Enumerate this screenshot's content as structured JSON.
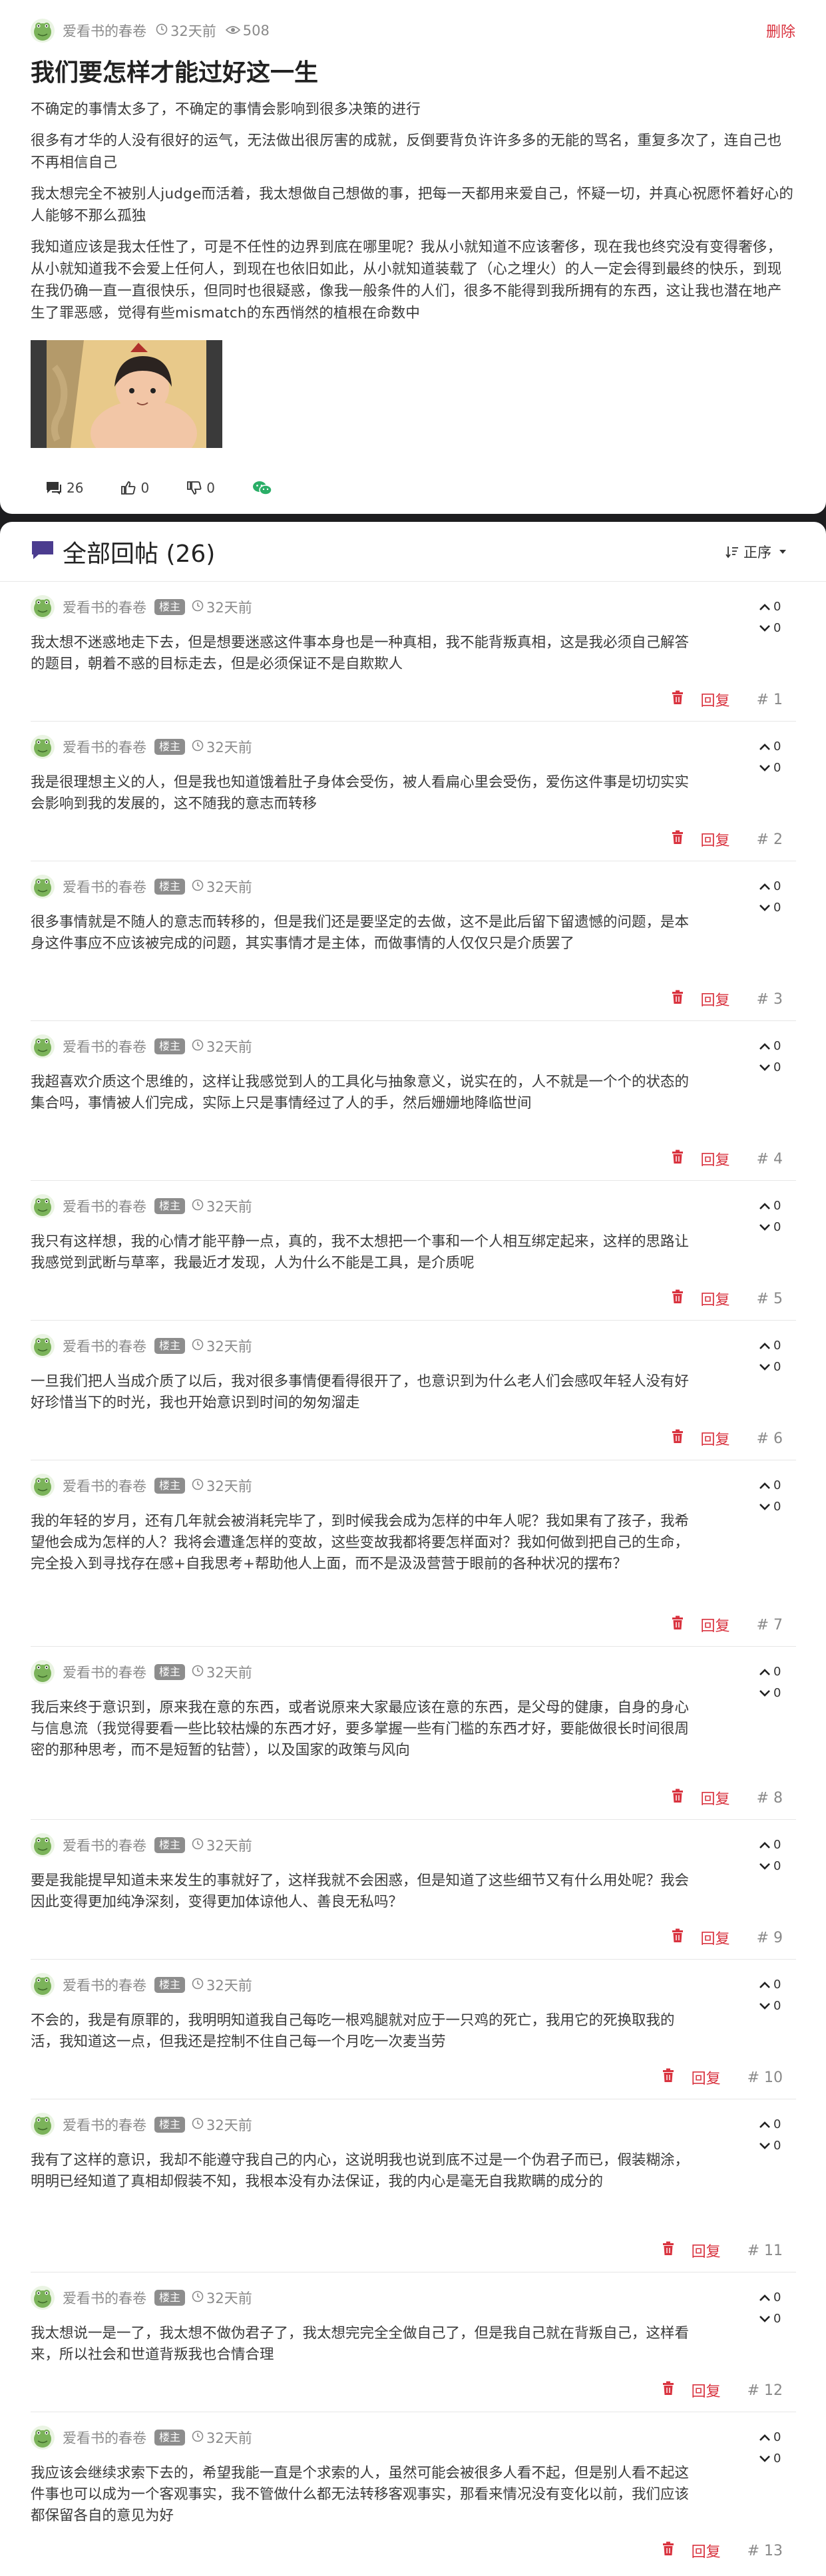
{
  "post": {
    "author": "爱看书的春卷",
    "time": "32天前",
    "views": "508",
    "delete_label": "删除",
    "title": "我们要怎样才能过好这一生",
    "paragraphs": [
      "不确定的事情太多了，不确定的事情会影响到很多决策的进行",
      "很多有才华的人没有很好的运气，无法做出很厉害的成就，反倒要背负许许多多的无能的骂名，重复多次了，连自己也不再相信自己",
      "我太想完全不被别人judge而活着，我太想做自己想做的事，把每一天都用来爱自己，怀疑一切，并真心祝愿怀着好心的人能够不那么孤独",
      "我知道应该是我太任性了，可是不任性的边界到底在哪里呢？我从小就知道不应该奢侈，现在我也终究没有变得奢侈，从小就知道我不会爱上任何人，到现在也依旧如此，从小就知道装载了（心之埋火）的人一定会得到最终的快乐，到现在我仍确一直一直很快乐，但同时也很疑惑，像我一般条件的人们，很多不能得到我所拥有的东西，这让我也潜在地产生了罪恶感，觉得有些mismatch的东西悄然的植根在命数中"
    ],
    "actions": {
      "comments": "26",
      "likes": "0",
      "dislikes": "0"
    }
  },
  "replies_header": {
    "title": "全部回帖 (26)",
    "sort_label": "正序"
  },
  "badge_label": "楼主",
  "reply_label": "回复",
  "replies": [
    {
      "author": "爱看书的春卷",
      "time": "32天前",
      "up": "0",
      "down": "0",
      "floor": "# 1",
      "body": "我太想不迷惑地走下去，但是想要迷惑这件事本身也是一种真相，我不能背叛真相，这是我必须自己解答的题目，朝着不惑的目标走去，但是必须保证不是自欺欺人"
    },
    {
      "author": "爱看书的春卷",
      "time": "32天前",
      "up": "0",
      "down": "0",
      "floor": "# 2",
      "body": "我是很理想主义的人，但是我也知道饿着肚子身体会受伤，被人看扁心里会受伤，爱伤这件事是切切实实会影响到我的发展的，这不随我的意志而转移"
    },
    {
      "author": "爱看书的春卷",
      "time": "32天前",
      "up": "0",
      "down": "0",
      "floor": "# 3",
      "body": "很多事情就是不随人的意志而转移的，但是我们还是要坚定的去做，这不是此后留下留遗憾的问题，是本身这件事应不应该被完成的问题，其实事情才是主体，而做事情的人仅仅只是介质罢了"
    },
    {
      "author": "爱看书的春卷",
      "time": "32天前",
      "up": "0",
      "down": "0",
      "floor": "# 4",
      "body": "我超喜欢介质这个思维的，这样让我感觉到人的工具化与抽象意义，说实在的，人不就是一个个的状态的集合吗，事情被人们完成，实际上只是事情经过了人的手，然后姗姗地降临世间"
    },
    {
      "author": "爱看书的春卷",
      "time": "32天前",
      "up": "0",
      "down": "0",
      "floor": "# 5",
      "body": "我只有这样想，我的心情才能平静一点，真的，我不太想把一个事和一个人相互绑定起来，这样的思路让我感觉到武断与草率，我最近才发现，人为什么不能是工具，是介质呢"
    },
    {
      "author": "爱看书的春卷",
      "time": "32天前",
      "up": "0",
      "down": "0",
      "floor": "# 6",
      "body": "一旦我们把人当成介质了以后，我对很多事情便看得很开了，也意识到为什么老人们会感叹年轻人没有好好珍惜当下的时光，我也开始意识到时间的匆匆溜走"
    },
    {
      "author": "爱看书的春卷",
      "time": "32天前",
      "up": "0",
      "down": "0",
      "floor": "# 7",
      "body": "我的年轻的岁月，还有几年就会被消耗完毕了，到时候我会成为怎样的中年人呢？我如果有了孩子，我希望他会成为怎样的人？我将会遭逢怎样的变故，这些变故我都将要怎样面对？我如何做到把自己的生命，完全投入到寻找存在感+自我思考+帮助他人上面，而不是汲汲营营于眼前的各种状况的摆布？"
    },
    {
      "author": "爱看书的春卷",
      "time": "32天前",
      "up": "0",
      "down": "0",
      "floor": "# 8",
      "body": "我后来终于意识到，原来我在意的东西，或者说原来大家最应该在意的东西，是父母的健康，自身的身心与信息流（我觉得要看一些比较枯燥的东西才好，要多掌握一些有门槛的东西才好，要能做很长时间很周密的那种思考，而不是短暂的钻营），以及国家的政策与风向"
    },
    {
      "author": "爱看书的春卷",
      "time": "32天前",
      "up": "0",
      "down": "0",
      "floor": "# 9",
      "body": "要是我能提早知道未来发生的事就好了，这样我就不会困惑，但是知道了这些细节又有什么用处呢？我会因此变得更加纯净深刻，变得更加体谅他人、善良无私吗？"
    },
    {
      "author": "爱看书的春卷",
      "time": "32天前",
      "up": "0",
      "down": "0",
      "floor": "# 10",
      "body": "不会的，我是有原罪的，我明明知道我自己每吃一根鸡腿就对应于一只鸡的死亡，我用它的死换取我的活，我知道这一点，但我还是控制不住自己每一个月吃一次麦当劳"
    },
    {
      "author": "爱看书的春卷",
      "time": "32天前",
      "up": "0",
      "down": "0",
      "floor": "# 11",
      "body": "我有了这样的意识，我却不能遵守我自己的内心，这说明我也说到底不过是一个伪君子而已，假装糊涂，明明已经知道了真相却假装不知，我根本没有办法保证，我的内心是毫无自我欺瞒的成分的"
    },
    {
      "author": "爱看书的春卷",
      "time": "32天前",
      "up": "0",
      "down": "0",
      "floor": "# 12",
      "body": "我太想说一是一了，我太想不做伪君子了，我太想完完全全做自己了，但是我自己就在背叛自己，这样看来，所以社会和世道背叛我也合情合理"
    },
    {
      "author": "爱看书的春卷",
      "time": "32天前",
      "up": "0",
      "down": "0",
      "floor": "# 13",
      "body": "我应该会继续求索下去的，希望我能一直是个求索的人，虽然可能会被很多人看不起，但是别人看不起这件事也可以成为一个客观事实，我不管做什么都无法转移客观事实，那看来情况没有变化以前，我们应该都保留各自的意见为好"
    }
  ]
}
